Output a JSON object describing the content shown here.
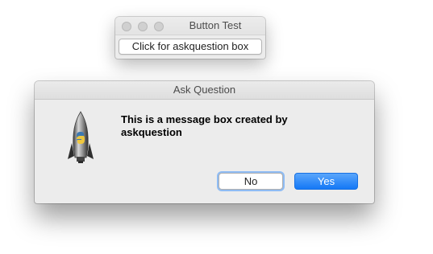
{
  "main_window": {
    "title": "Button Test",
    "button_label": "Click for askquestion box"
  },
  "dialog": {
    "title": "Ask Question",
    "icon": "python-rocket-icon",
    "message": "This is a message box created by askquestion",
    "buttons": {
      "no_label": "No",
      "yes_label": "Yes"
    }
  },
  "colors": {
    "accent": "#1478f6",
    "window_bg": "#ececec"
  }
}
